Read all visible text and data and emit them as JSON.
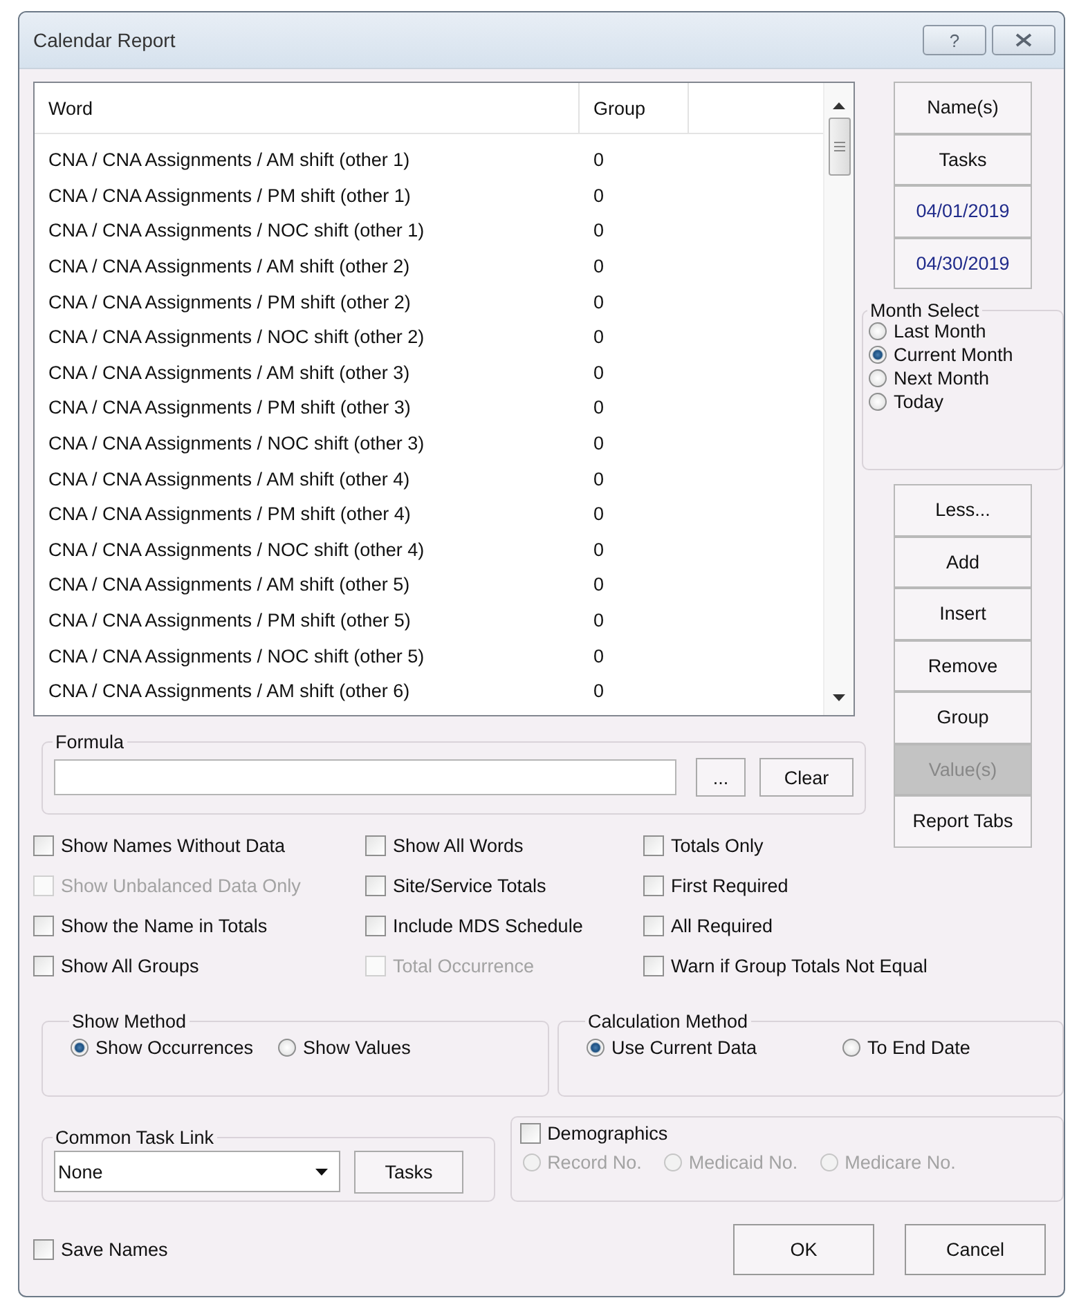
{
  "window": {
    "title": "Calendar Report",
    "help_button": "?"
  },
  "word_table": {
    "columns": [
      "Word",
      "Group"
    ],
    "rows": [
      {
        "word": "CNA / CNA Assignments / AM shift (other 1)",
        "group": "0"
      },
      {
        "word": "CNA / CNA Assignments / PM shift (other 1)",
        "group": "0"
      },
      {
        "word": "CNA / CNA Assignments / NOC shift (other 1)",
        "group": "0"
      },
      {
        "word": "CNA / CNA Assignments / AM shift (other 2)",
        "group": "0"
      },
      {
        "word": "CNA / CNA Assignments / PM shift (other 2)",
        "group": "0"
      },
      {
        "word": "CNA / CNA Assignments / NOC shift (other 2)",
        "group": "0"
      },
      {
        "word": "CNA / CNA Assignments / AM shift (other 3)",
        "group": "0"
      },
      {
        "word": "CNA / CNA Assignments / PM shift (other 3)",
        "group": "0"
      },
      {
        "word": "CNA / CNA Assignments / NOC shift (other 3)",
        "group": "0"
      },
      {
        "word": "CNA / CNA Assignments / AM shift (other 4)",
        "group": "0"
      },
      {
        "word": "CNA / CNA Assignments / PM shift (other 4)",
        "group": "0"
      },
      {
        "word": "CNA / CNA Assignments / NOC shift (other 4)",
        "group": "0"
      },
      {
        "word": "CNA / CNA Assignments / AM shift (other 5)",
        "group": "0"
      },
      {
        "word": "CNA / CNA Assignments / PM shift (other 5)",
        "group": "0"
      },
      {
        "word": "CNA / CNA Assignments / NOC shift (other 5)",
        "group": "0"
      },
      {
        "word": "CNA / CNA Assignments / AM shift (other 6)",
        "group": "0"
      }
    ]
  },
  "top_buttons": [
    {
      "label": "Name(s)",
      "kind": "button",
      "disabled": false
    },
    {
      "label": "Tasks",
      "kind": "button",
      "disabled": false
    },
    {
      "label": "04/01/2019",
      "kind": "date",
      "disabled": false
    },
    {
      "label": "04/30/2019",
      "kind": "date",
      "disabled": false
    }
  ],
  "month_select": {
    "title": "Month Select",
    "options": [
      {
        "label": "Last Month",
        "selected": false
      },
      {
        "label": "Current Month",
        "selected": true
      },
      {
        "label": "Next Month",
        "selected": false
      },
      {
        "label": "Today",
        "selected": false
      }
    ]
  },
  "side_buttons": [
    {
      "label": "Less...",
      "disabled": false
    },
    {
      "label": "Add",
      "disabled": false
    },
    {
      "label": "Insert",
      "disabled": false
    },
    {
      "label": "Remove",
      "disabled": false
    },
    {
      "label": "Group",
      "disabled": false
    },
    {
      "label": "Value(s)",
      "disabled": true
    },
    {
      "label": "Report Tabs",
      "disabled": false
    }
  ],
  "formula": {
    "title": "Formula",
    "browse_button": "...",
    "clear_button": "Clear"
  },
  "options": [
    {
      "label": "Show Names Without Data",
      "checked": false,
      "disabled": false
    },
    {
      "label": "Show All Words",
      "checked": false,
      "disabled": false
    },
    {
      "label": "Totals Only",
      "checked": false,
      "disabled": false
    },
    {
      "label": "Show Unbalanced Data Only",
      "checked": false,
      "disabled": true
    },
    {
      "label": "Site/Service Totals",
      "checked": false,
      "disabled": false
    },
    {
      "label": "First Required",
      "checked": false,
      "disabled": false
    },
    {
      "label": "Show the Name in Totals",
      "checked": false,
      "disabled": false
    },
    {
      "label": "Include MDS Schedule",
      "checked": false,
      "disabled": false
    },
    {
      "label": "All Required",
      "checked": false,
      "disabled": false
    },
    {
      "label": "Show All Groups",
      "checked": false,
      "disabled": false
    },
    {
      "label": "Total Occurrence",
      "checked": false,
      "disabled": true
    },
    {
      "label": "Warn if Group Totals Not Equal",
      "checked": false,
      "disabled": false
    }
  ],
  "show_method": {
    "title": "Show Method",
    "options": [
      {
        "label": "Show Occurrences",
        "selected": true
      },
      {
        "label": "Show Values",
        "selected": false
      }
    ]
  },
  "calculation_method": {
    "title": "Calculation Method",
    "options": [
      {
        "label": "Use Current Data",
        "selected": true
      },
      {
        "label": "To End Date",
        "selected": false
      }
    ]
  },
  "common_task_link": {
    "title": "Common Task Link",
    "value": "None",
    "button": "Tasks"
  },
  "demographics": {
    "label": "Demographics",
    "checked": false,
    "options": [
      {
        "label": "Record No.",
        "selected": false,
        "disabled": true
      },
      {
        "label": "Medicaid No.",
        "selected": false,
        "disabled": true
      },
      {
        "label": "Medicare No.",
        "selected": false,
        "disabled": true
      }
    ]
  },
  "save_names": {
    "label": "Save Names",
    "checked": false
  },
  "buttons": [
    "OK",
    "Cancel"
  ]
}
